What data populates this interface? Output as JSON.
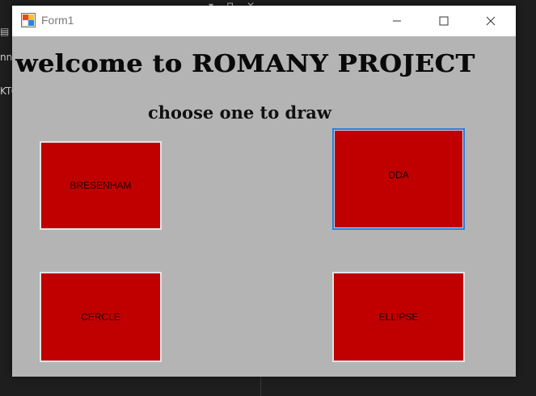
{
  "background": {
    "fragment_1": "nn",
    "fragment_2": "KTC"
  },
  "window": {
    "title": "Form1",
    "minimize_glyph": "—",
    "maximize_glyph": "☐",
    "close_glyph": "✕"
  },
  "form": {
    "heading": "welcome to ROMANY PROJECT",
    "subheading": "choose one to draw",
    "buttons": {
      "bresenham": "BRESENHAM",
      "dda": "DDA",
      "cercle": "CERCLE",
      "ellipse": "ELLIPSE"
    }
  },
  "colors": {
    "button_fill": "#c00000",
    "form_background": "#b4b4b4",
    "focus_border": "#2a7fd8"
  },
  "icons": {
    "app": "form-icon",
    "minimize": "minimize-icon",
    "maximize": "maximize-icon",
    "close": "close-icon"
  }
}
